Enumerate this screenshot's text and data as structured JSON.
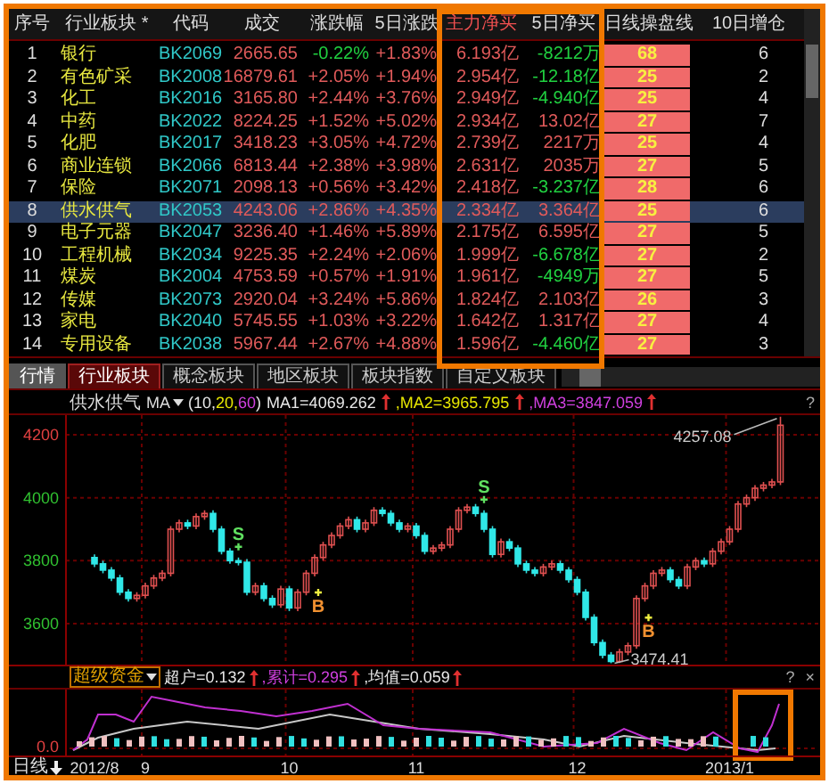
{
  "table": {
    "columns": [
      {
        "label": "序号",
        "sorted": false
      },
      {
        "label": "行业板块 *",
        "sorted": false
      },
      {
        "label": "代码",
        "sorted": false
      },
      {
        "label": "成交",
        "sorted": false
      },
      {
        "label": "涨跌幅",
        "sorted": false
      },
      {
        "label": "5日涨跌",
        "sorted": false
      },
      {
        "label": "主力净买",
        "sorted": true
      },
      {
        "label": "5日净买",
        "sorted": false
      },
      {
        "label": "日线操盘线",
        "sorted": false
      },
      {
        "label": "10日增仓",
        "sorted": false
      }
    ],
    "rows": [
      {
        "index": "1",
        "name": "银行",
        "code": "BK2069",
        "volume": "2665.65",
        "change": "-0.22%",
        "change_up": false,
        "change_5d": "+1.83%",
        "main_net_buy": "6.193亿",
        "net_buy_5d": "-8212万",
        "net_buy_5d_up": false,
        "daily_line": "68",
        "increase_10d": "6",
        "selected": false
      },
      {
        "index": "2",
        "name": "有色矿采",
        "code": "BK2008",
        "volume": "16879.61",
        "change": "+2.05%",
        "change_up": true,
        "change_5d": "+1.94%",
        "main_net_buy": "2.954亿",
        "net_buy_5d": "-12.18亿",
        "net_buy_5d_up": false,
        "daily_line": "25",
        "increase_10d": "2",
        "selected": false
      },
      {
        "index": "3",
        "name": "化工",
        "code": "BK2016",
        "volume": "3165.80",
        "change": "+2.44%",
        "change_up": true,
        "change_5d": "+3.76%",
        "main_net_buy": "2.949亿",
        "net_buy_5d": "-4.940亿",
        "net_buy_5d_up": false,
        "daily_line": "25",
        "increase_10d": "4",
        "selected": false
      },
      {
        "index": "4",
        "name": "中药",
        "code": "BK2022",
        "volume": "8224.25",
        "change": "+1.52%",
        "change_up": true,
        "change_5d": "+5.02%",
        "main_net_buy": "2.934亿",
        "net_buy_5d": "13.02亿",
        "net_buy_5d_up": true,
        "daily_line": "27",
        "increase_10d": "7",
        "selected": false
      },
      {
        "index": "5",
        "name": "化肥",
        "code": "BK2017",
        "volume": "3418.23",
        "change": "+3.05%",
        "change_up": true,
        "change_5d": "+4.72%",
        "main_net_buy": "2.739亿",
        "net_buy_5d": "2217万",
        "net_buy_5d_up": true,
        "daily_line": "25",
        "increase_10d": "4",
        "selected": false
      },
      {
        "index": "6",
        "name": "商业连锁",
        "code": "BK2066",
        "volume": "6813.44",
        "change": "+2.38%",
        "change_up": true,
        "change_5d": "+3.98%",
        "main_net_buy": "2.631亿",
        "net_buy_5d": "2035万",
        "net_buy_5d_up": true,
        "daily_line": "27",
        "increase_10d": "5",
        "selected": false
      },
      {
        "index": "7",
        "name": "保险",
        "code": "BK2071",
        "volume": "2098.13",
        "change": "+0.56%",
        "change_up": true,
        "change_5d": "+3.42%",
        "main_net_buy": "2.418亿",
        "net_buy_5d": "-3.237亿",
        "net_buy_5d_up": false,
        "daily_line": "28",
        "increase_10d": "6",
        "selected": false
      },
      {
        "index": "8",
        "name": "供水供气",
        "code": "BK2053",
        "volume": "4243.06",
        "change": "+2.86%",
        "change_up": true,
        "change_5d": "+4.35%",
        "main_net_buy": "2.334亿",
        "net_buy_5d": "3.364亿",
        "net_buy_5d_up": true,
        "daily_line": "25",
        "increase_10d": "6",
        "selected": true
      },
      {
        "index": "9",
        "name": "电子元器",
        "code": "BK2047",
        "volume": "3236.40",
        "change": "+1.46%",
        "change_up": true,
        "change_5d": "+5.89%",
        "main_net_buy": "2.175亿",
        "net_buy_5d": "6.595亿",
        "net_buy_5d_up": true,
        "daily_line": "27",
        "increase_10d": "5",
        "selected": false
      },
      {
        "index": "10",
        "name": "工程机械",
        "code": "BK2034",
        "volume": "9225.35",
        "change": "+2.24%",
        "change_up": true,
        "change_5d": "+2.06%",
        "main_net_buy": "1.999亿",
        "net_buy_5d": "-6.678亿",
        "net_buy_5d_up": false,
        "daily_line": "27",
        "increase_10d": "2",
        "selected": false
      },
      {
        "index": "11",
        "name": "煤炭",
        "code": "BK2004",
        "volume": "4753.59",
        "change": "+0.57%",
        "change_up": true,
        "change_5d": "+1.91%",
        "main_net_buy": "1.961亿",
        "net_buy_5d": "-4949万",
        "net_buy_5d_up": false,
        "daily_line": "27",
        "increase_10d": "5",
        "selected": false
      },
      {
        "index": "12",
        "name": "传媒",
        "code": "BK2073",
        "volume": "2920.04",
        "change": "+3.24%",
        "change_up": true,
        "change_5d": "+5.86%",
        "main_net_buy": "1.824亿",
        "net_buy_5d": "2.103亿",
        "net_buy_5d_up": true,
        "daily_line": "26",
        "increase_10d": "3",
        "selected": false
      },
      {
        "index": "13",
        "name": "家电",
        "code": "BK2040",
        "volume": "5745.55",
        "change": "+1.03%",
        "change_up": true,
        "change_5d": "+3.22%",
        "main_net_buy": "1.642亿",
        "net_buy_5d": "1.317亿",
        "net_buy_5d_up": true,
        "daily_line": "27",
        "increase_10d": "4",
        "selected": false
      },
      {
        "index": "14",
        "name": "专用设备",
        "code": "BK2038",
        "volume": "5967.44",
        "change": "+2.67%",
        "change_up": true,
        "change_5d": "+4.88%",
        "main_net_buy": "1.596亿",
        "net_buy_5d": "-4.460亿",
        "net_buy_5d_up": false,
        "daily_line": "27",
        "increase_10d": "3",
        "selected": false
      }
    ]
  },
  "tabs": [
    {
      "label": "行情",
      "kind": "market",
      "selected": false
    },
    {
      "label": "行业板块",
      "kind": "sector",
      "selected": true
    },
    {
      "label": "概念板块",
      "kind": "sector",
      "selected": false
    },
    {
      "label": "地区板块",
      "kind": "sector",
      "selected": false
    },
    {
      "label": "板块指数",
      "kind": "sector",
      "selected": false
    },
    {
      "label": "自定义板块",
      "kind": "sector",
      "selected": false
    }
  ],
  "chart": {
    "title": "供水供气",
    "ma_selector": "MA",
    "ma_params": [
      {
        "text": "(10,",
        "color": "#e8e8e8"
      },
      {
        "text": "20,",
        "color": "#e8e800"
      },
      {
        "text": "60",
        "color": "#d040e0"
      },
      {
        "text": ")",
        "color": "#e8e8e8"
      }
    ],
    "ytick_marks": [
      {
        "color": "#e04040"
      },
      {
        "color": "#30c030"
      },
      {
        "color": "#30c030"
      },
      {
        "color": "#30c030"
      }
    ],
    "signals": [
      {
        "letter": "S",
        "kind": "sell"
      },
      {
        "letter": "B",
        "kind": "buy"
      },
      {
        "letter": "S",
        "kind": "sell"
      },
      {
        "letter": "B",
        "kind": "buy"
      }
    ],
    "ma_values": [
      {
        "label": "MA1=4069.262",
        "color": "#e8e8e8"
      },
      {
        "label": ",MA2=3965.795",
        "color": "#e8e800"
      },
      {
        "label": ",MA3=3847.059",
        "color": "#d040e0"
      }
    ],
    "help": "?",
    "high_label": "4257.08",
    "low_label": "3474.41",
    "chart_data": {
      "type": "candlestick",
      "categories": [
        "2012/8",
        null,
        null,
        null,
        null,
        null,
        "9",
        null,
        null,
        null,
        null,
        null,
        null,
        null,
        null,
        null,
        null,
        null,
        null,
        null,
        null,
        null,
        null,
        "10",
        null,
        null,
        null,
        null,
        null,
        null,
        null,
        null,
        null,
        null,
        null,
        null,
        null,
        null,
        "11",
        null,
        null,
        null,
        null,
        null,
        null,
        null,
        null,
        null,
        null,
        null,
        null,
        null,
        null,
        null,
        null,
        null,
        null,
        "12",
        null,
        null,
        null,
        null,
        null,
        null,
        null,
        null,
        null,
        null,
        null,
        null,
        null,
        null,
        null,
        null,
        null,
        "2013/1",
        null,
        null,
        null,
        null,
        null,
        null
      ],
      "ohlc": [
        [
          3810,
          3820,
          3780,
          3790
        ],
        [
          3790,
          3800,
          3760,
          3770
        ],
        [
          3770,
          3780,
          3735,
          3745
        ],
        [
          3745,
          3755,
          3690,
          3700
        ],
        [
          3700,
          3710,
          3670,
          3680
        ],
        [
          3680,
          3700,
          3670,
          3690
        ],
        [
          3690,
          3730,
          3680,
          3720
        ],
        [
          3720,
          3755,
          3710,
          3745
        ],
        [
          3745,
          3770,
          3735,
          3760
        ],
        [
          3760,
          3910,
          3750,
          3900
        ],
        [
          3900,
          3930,
          3890,
          3920
        ],
        [
          3920,
          3930,
          3900,
          3910
        ],
        [
          3910,
          3950,
          3900,
          3940
        ],
        [
          3940,
          3960,
          3930,
          3950
        ],
        [
          3950,
          3960,
          3890,
          3900
        ],
        [
          3900,
          3910,
          3820,
          3830
        ],
        [
          3830,
          3840,
          3790,
          3800
        ],
        [
          3800,
          3810,
          3785,
          3795
        ],
        [
          3795,
          3805,
          3690,
          3700
        ],
        [
          3700,
          3730,
          3690,
          3720
        ],
        [
          3720,
          3730,
          3670,
          3680
        ],
        [
          3680,
          3690,
          3650,
          3660
        ],
        [
          3660,
          3720,
          3650,
          3710
        ],
        [
          3710,
          3720,
          3640,
          3650
        ],
        [
          3650,
          3710,
          3640,
          3700
        ],
        [
          3700,
          3770,
          3690,
          3760
        ],
        [
          3760,
          3820,
          3750,
          3810
        ],
        [
          3810,
          3860,
          3800,
          3850
        ],
        [
          3850,
          3890,
          3840,
          3880
        ],
        [
          3880,
          3920,
          3870,
          3910
        ],
        [
          3910,
          3940,
          3900,
          3930
        ],
        [
          3930,
          3940,
          3890,
          3900
        ],
        [
          3900,
          3930,
          3890,
          3920
        ],
        [
          3920,
          3970,
          3910,
          3960
        ],
        [
          3960,
          3970,
          3940,
          3950
        ],
        [
          3950,
          3960,
          3910,
          3920
        ],
        [
          3920,
          3930,
          3890,
          3900
        ],
        [
          3900,
          3920,
          3890,
          3910
        ],
        [
          3910,
          3920,
          3870,
          3880
        ],
        [
          3880,
          3890,
          3820,
          3830
        ],
        [
          3830,
          3850,
          3820,
          3840
        ],
        [
          3840,
          3860,
          3830,
          3850
        ],
        [
          3850,
          3910,
          3840,
          3900
        ],
        [
          3900,
          3970,
          3890,
          3960
        ],
        [
          3960,
          3980,
          3950,
          3970
        ],
        [
          3970,
          3980,
          3940,
          3950
        ],
        [
          3950,
          3960,
          3890,
          3900
        ],
        [
          3900,
          3910,
          3810,
          3820
        ],
        [
          3820,
          3870,
          3810,
          3860
        ],
        [
          3860,
          3870,
          3830,
          3840
        ],
        [
          3840,
          3850,
          3780,
          3790
        ],
        [
          3790,
          3800,
          3760,
          3770
        ],
        [
          3770,
          3780,
          3750,
          3760
        ],
        [
          3760,
          3790,
          3750,
          3780
        ],
        [
          3780,
          3800,
          3770,
          3790
        ],
        [
          3790,
          3800,
          3760,
          3770
        ],
        [
          3770,
          3780,
          3730,
          3740
        ],
        [
          3740,
          3750,
          3690,
          3700
        ],
        [
          3700,
          3710,
          3610,
          3620
        ],
        [
          3620,
          3630,
          3530,
          3540
        ],
        [
          3540,
          3550,
          3490,
          3500
        ],
        [
          3500,
          3510,
          3474.41,
          3480
        ],
        [
          3480,
          3520,
          3475,
          3510
        ],
        [
          3510,
          3540,
          3500,
          3530
        ],
        [
          3530,
          3690,
          3520,
          3680
        ],
        [
          3680,
          3730,
          3670,
          3720
        ],
        [
          3720,
          3770,
          3710,
          3760
        ],
        [
          3760,
          3780,
          3750,
          3770
        ],
        [
          3770,
          3780,
          3730,
          3740
        ],
        [
          3740,
          3750,
          3710,
          3720
        ],
        [
          3720,
          3790,
          3710,
          3780
        ],
        [
          3780,
          3810,
          3770,
          3800
        ],
        [
          3800,
          3810,
          3780,
          3790
        ],
        [
          3790,
          3840,
          3780,
          3830
        ],
        [
          3830,
          3870,
          3820,
          3860
        ],
        [
          3860,
          3910,
          3850,
          3900
        ],
        [
          3900,
          3990,
          3890,
          3980
        ],
        [
          3980,
          4010,
          3970,
          4000
        ],
        [
          4000,
          4040,
          3990,
          4030
        ],
        [
          4030,
          4050,
          4020,
          4040
        ],
        [
          4040,
          4060,
          4030,
          4050
        ],
        [
          4050,
          4257.08,
          4040,
          4230
        ]
      ],
      "ylim": [
        3470,
        4262
      ],
      "grid": true,
      "yticks": [
        {
          "value": 4200,
          "label": "4200"
        },
        {
          "value": 4000,
          "label": "4000"
        },
        {
          "value": 3800,
          "label": "3800"
        },
        {
          "value": 3600,
          "label": "3600"
        }
      ]
    }
  },
  "indicator": {
    "selector": "超级资金",
    "values": [
      {
        "label": "超户=0.132",
        "color": "#e8e8e8"
      },
      {
        "label": ",累计=0.295",
        "color": "#d040e0"
      },
      {
        "label": ",均值=0.059",
        "color": "#e8e8e8"
      }
    ],
    "help": "?",
    "close": "×",
    "zero_label": "0.0"
  },
  "xaxis": {
    "period": "日线"
  }
}
